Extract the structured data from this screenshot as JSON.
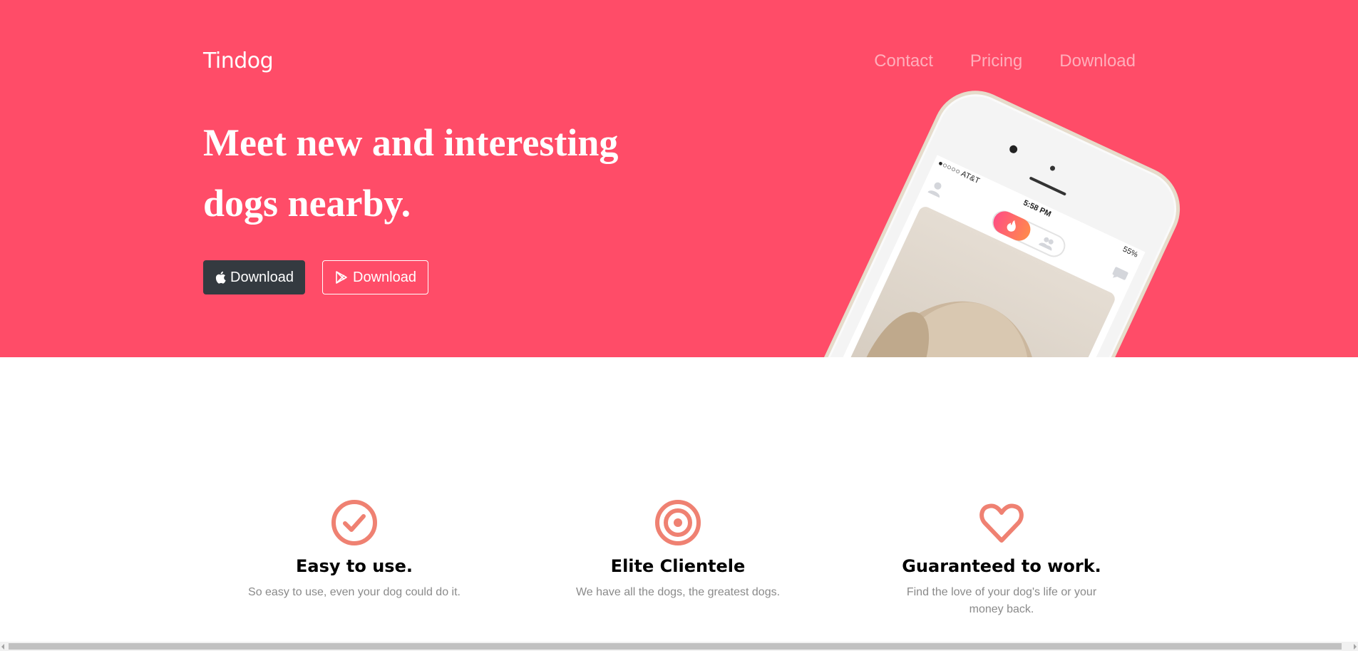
{
  "brand": "Tindog",
  "nav": [
    {
      "label": "Contact"
    },
    {
      "label": "Pricing"
    },
    {
      "label": "Download"
    }
  ],
  "hero": {
    "title": "Meet new and interesting dogs nearby.",
    "buttons": [
      {
        "label": "Download",
        "icon": "apple-icon"
      },
      {
        "label": "Download",
        "icon": "google-play-icon"
      }
    ]
  },
  "phone": {
    "carrier": "●○○○○ AT&T",
    "time": "5:58 PM",
    "battery": "55%"
  },
  "features": [
    {
      "icon": "check-circle-icon",
      "title": "Easy to use.",
      "text": "So easy to use, even your dog could do it."
    },
    {
      "icon": "bullseye-icon",
      "title": "Elite Clientele",
      "text": "We have all the dogs, the greatest dogs."
    },
    {
      "icon": "heart-icon",
      "title": "Guaranteed to work.",
      "text": "Find the love of your dog's life or your money back."
    }
  ],
  "colors": {
    "hero": "#ff4c68",
    "icon": "#ef8172",
    "dark_button": "#343a40"
  }
}
